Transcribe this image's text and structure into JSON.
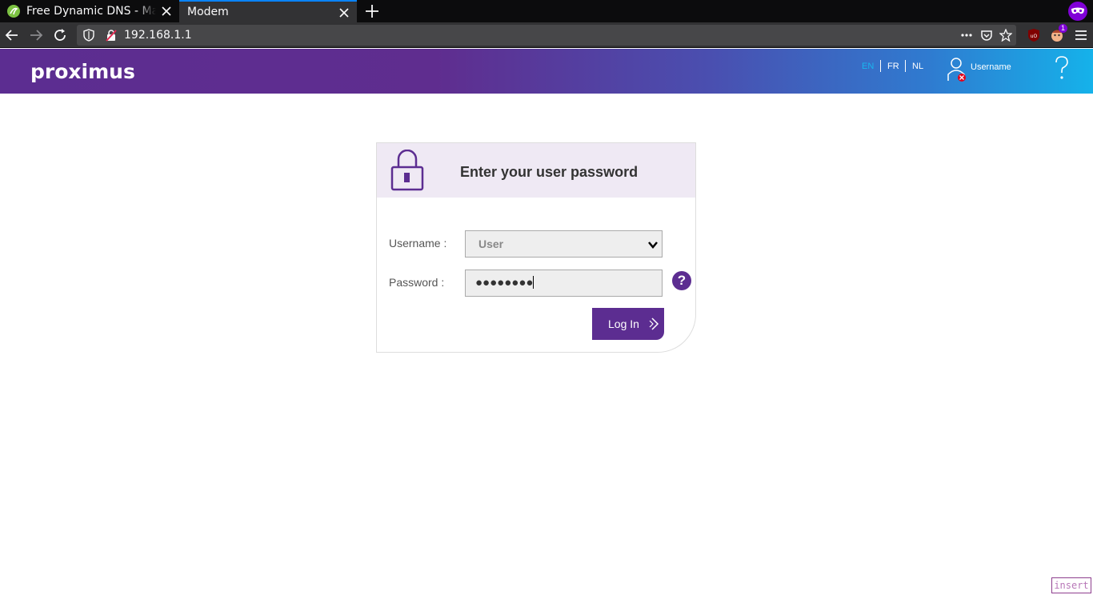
{
  "browser": {
    "tabs": [
      {
        "title": "Free Dynamic DNS - Man",
        "active": false
      },
      {
        "title": "Modem",
        "active": true
      }
    ],
    "url": "192.168.1.1",
    "extension_badge": "1"
  },
  "header": {
    "logo": "proximus",
    "languages": [
      "EN",
      "FR",
      "NL"
    ],
    "active_language": "EN",
    "user_label": "Username",
    "colors": {
      "brand": "#5c2d91",
      "accent": "#19b6ef"
    }
  },
  "login": {
    "title": "Enter your user password",
    "username_label": "Username :",
    "username_value": "User",
    "password_label": "Password :",
    "password_value": "●●●●●●●●",
    "help_label": "?",
    "login_button": "Log In"
  },
  "status": {
    "mode_badge": "insert"
  }
}
